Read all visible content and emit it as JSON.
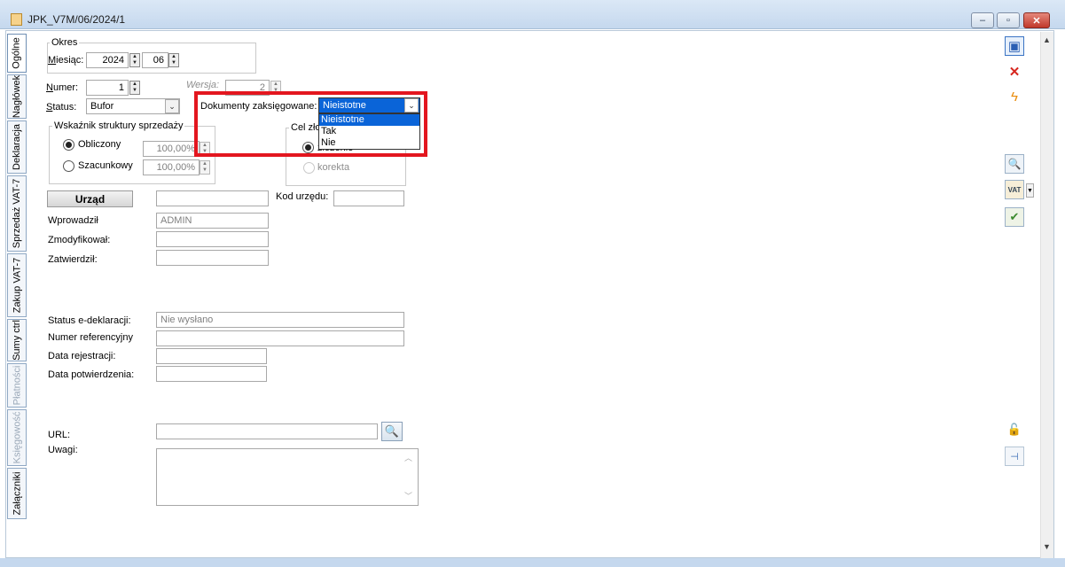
{
  "window": {
    "title": "JPK_V7M/06/2024/1",
    "controls": {
      "minimize": "‒",
      "maximize": "▫",
      "close": "✕"
    }
  },
  "tabs": [
    {
      "label": "Ogólne",
      "state": "active"
    },
    {
      "label": "Nagłówek",
      "state": "normal"
    },
    {
      "label": "Deklaracja",
      "state": "normal"
    },
    {
      "label": "Sprzedaż VAT-7",
      "state": "normal"
    },
    {
      "label": "Zakup VAT-7",
      "state": "normal"
    },
    {
      "label": "Sumy ctrl",
      "state": "normal"
    },
    {
      "label": "Płatności",
      "state": "disabled"
    },
    {
      "label": "Księgowość",
      "state": "disabled"
    },
    {
      "label": "Załączniki",
      "state": "normal"
    }
  ],
  "okres": {
    "legend": "Okres",
    "miesiac_label": "Miesiąc:",
    "year": "2024",
    "month": "06"
  },
  "numer": {
    "label": "Numer:",
    "value": "1"
  },
  "wersja": {
    "label": "Wersja:",
    "value": "2"
  },
  "status": {
    "label": "Status:",
    "value": "Bufor"
  },
  "dokumenty": {
    "label": "Dokumenty zaksięgowane:",
    "selected": "Nieistotne",
    "options": [
      "Nieistotne",
      "Tak",
      "Nie"
    ]
  },
  "wskaznik": {
    "legend": "Wskaźnik struktury sprzedaży",
    "obliczony_label": "Obliczony",
    "obliczony_value": "100,00%",
    "szacunkowy_label": "Szacunkowy",
    "szacunkowy_value": "100,00%"
  },
  "cel": {
    "legend_visible": "Cel zło",
    "option1_visible": "złożenie",
    "option2": "korekta"
  },
  "urzad": {
    "button_label": "Urząd",
    "value": "",
    "kod_label": "Kod urzędu:",
    "kod_value": ""
  },
  "wprowadzil": {
    "label": "Wprowadził",
    "value": "ADMIN"
  },
  "zmodyfikowal": {
    "label": "Zmodyfikował:",
    "value": ""
  },
  "zatwierdzil": {
    "label": "Zatwierdził:",
    "value": ""
  },
  "edeklaracja": {
    "status_label": "Status e-deklaracji:",
    "status_value": "Nie wysłano",
    "numer_label": "Numer referencyjny",
    "numer_value": "",
    "data_rej_label": "Data rejestracji:",
    "data_rej_value": "",
    "data_potw_label": "Data potwierdzenia:",
    "data_potw_value": ""
  },
  "url": {
    "label": "URL:",
    "value": ""
  },
  "uwagi": {
    "label": "Uwagi:",
    "value": ""
  },
  "toolbar_icons": [
    "save-icon",
    "close-icon",
    "lightning-icon",
    "preview-icon",
    "vat-icon",
    "approve-icon",
    "lock-icon",
    "pin-icon"
  ],
  "colors": {
    "highlight": "#e3161f",
    "selection": "#0a64d8"
  }
}
